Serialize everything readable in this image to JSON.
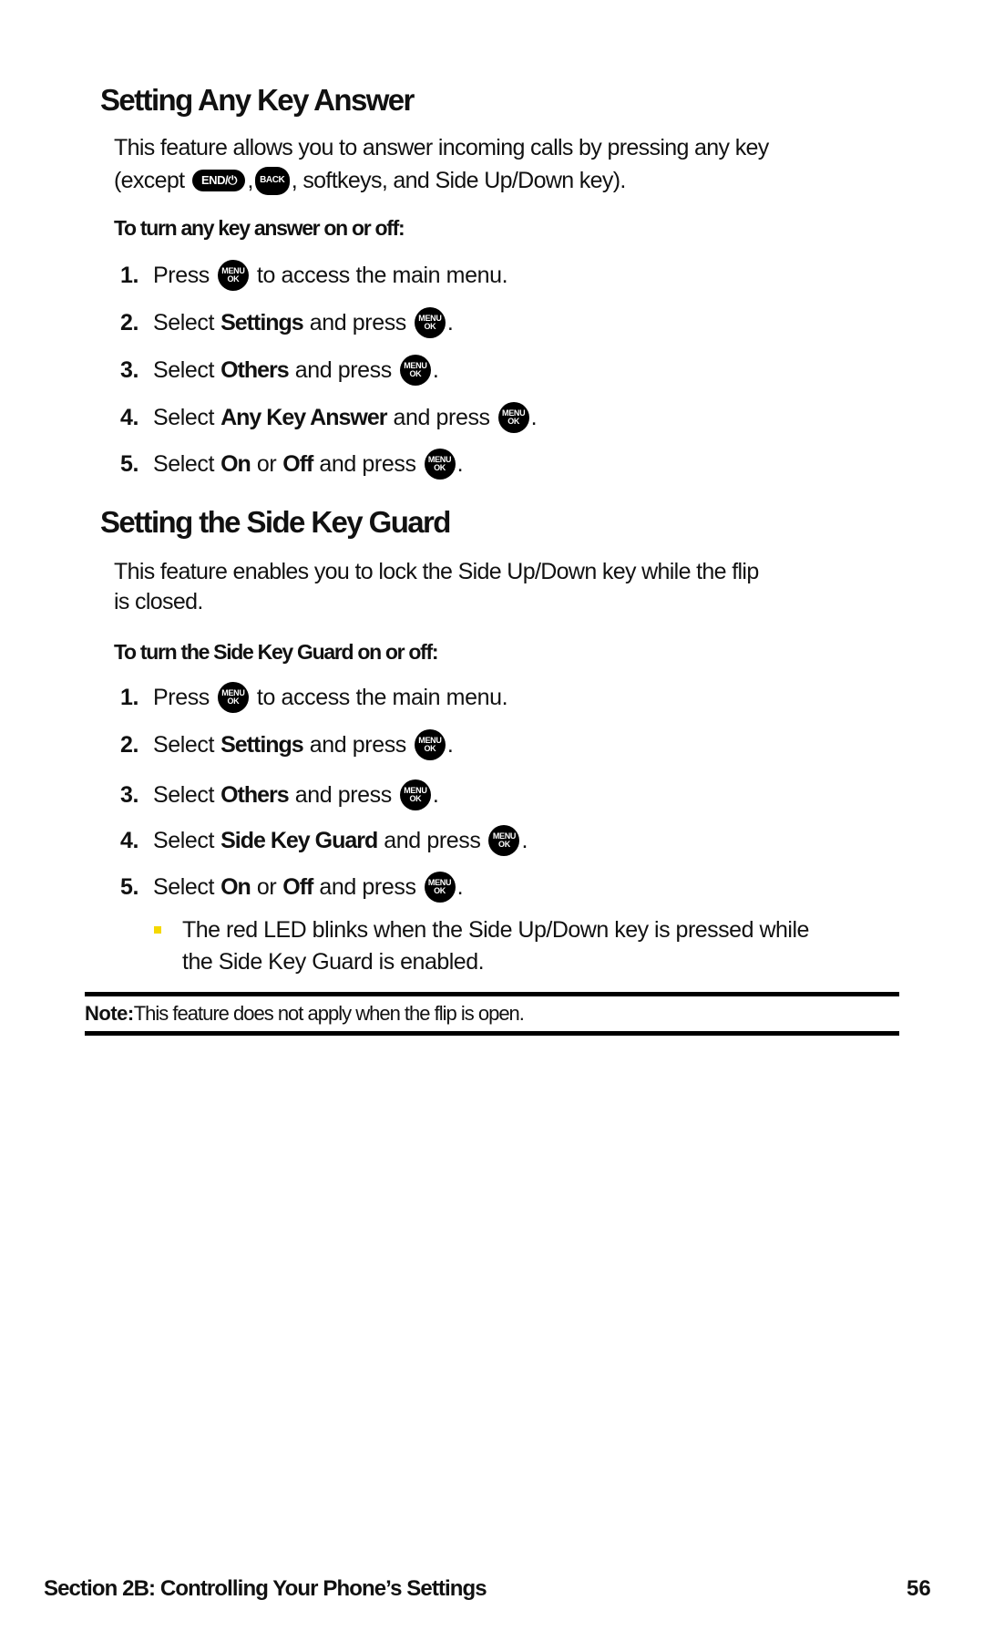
{
  "section1": {
    "title": "Setting Any Key Answer",
    "intro_line1": "This feature allows you to answer incoming calls by pressing any key",
    "intro_line2_prefix": "(except",
    "intro_line2_sep": ",",
    "intro_line2_suffix": ", softkeys, and Side Up/Down key).",
    "end_key_label": "END/⏻",
    "back_key_label": "BACK",
    "subheading": "To turn any key answer on or off:",
    "steps": [
      {
        "num": "1.",
        "pre": "Press",
        "bold": "",
        "mid": "",
        "bold2": "",
        "post": "to access the main menu.",
        "key_after": false
      },
      {
        "num": "2.",
        "pre": "Select",
        "bold": "Settings",
        "mid": "and press",
        "bold2": "",
        "post": ".",
        "key_after": true
      },
      {
        "num": "3.",
        "pre": "Select",
        "bold": "Others",
        "mid": "and press",
        "bold2": "",
        "post": ".",
        "key_after": true
      },
      {
        "num": "4.",
        "pre": "Select",
        "bold": "Any Key Answer",
        "mid": "and press",
        "bold2": "",
        "post": ".",
        "key_after": true
      },
      {
        "num": "5.",
        "pre": "Select",
        "bold": "On",
        "or": "or",
        "bold2": "Off",
        "mid": "and press",
        "post": ".",
        "key_after": true
      }
    ]
  },
  "section2": {
    "title": "Setting the Side Key Guard",
    "intro_line1": "This feature enables you to lock the Side Up/Down key while the flip",
    "intro_line2": "is closed.",
    "subheading": "To turn the Side Key Guard on or off:",
    "steps": [
      {
        "num": "1.",
        "pre": "Press",
        "post": "to access the main menu."
      },
      {
        "num": "2.",
        "pre": "Select",
        "bold": "Settings",
        "mid": "and press",
        "post": "."
      },
      {
        "num": "3.",
        "pre": "Select",
        "bold": "Others",
        "mid": "and press",
        "post": "."
      },
      {
        "num": "4.",
        "pre": "Select",
        "bold": "Side Key Guard",
        "mid": "and press",
        "post": "."
      },
      {
        "num": "5.",
        "pre": "Select",
        "bold": "On",
        "or": "or",
        "bold2": "Off",
        "mid": "and press",
        "post": "."
      }
    ],
    "bullet_line1": "The red LED blinks when the Side Up/Down key is pressed while",
    "bullet_line2": "the Side Key Guard is enabled."
  },
  "menu_key": {
    "top": "MENU",
    "bottom": "OK"
  },
  "note": {
    "label": "Note:",
    "text": "This feature does not apply when the flip is open."
  },
  "footer": {
    "section": "Section 2B: Controlling Your Phone’s Settings",
    "page": "56"
  },
  "colors": {
    "bullet": "#f5d800",
    "text": "#111111",
    "key_bg": "#000000"
  }
}
